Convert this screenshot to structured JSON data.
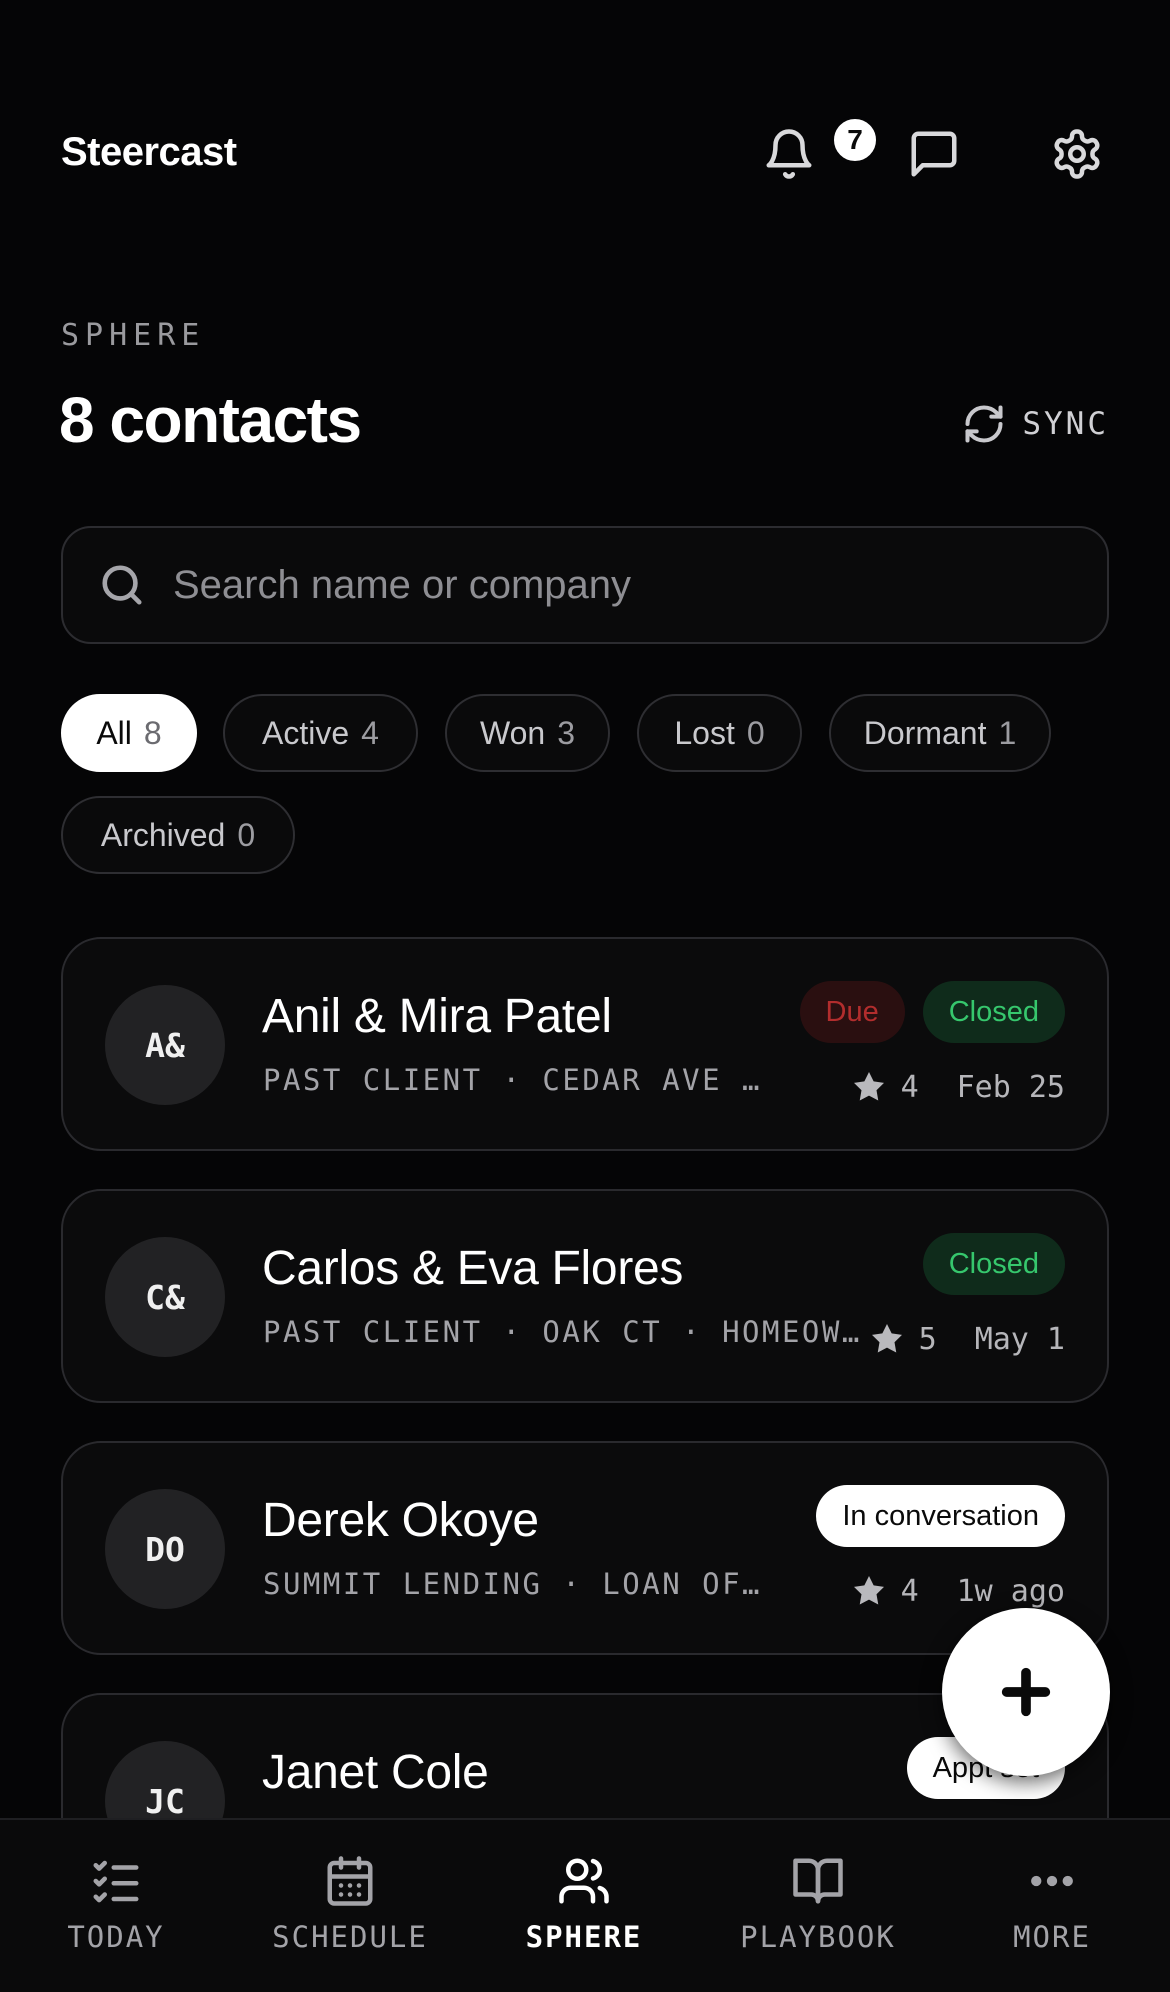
{
  "header": {
    "brand": "Steercast",
    "notifications_count": "7"
  },
  "section": {
    "eyebrow": "SPHERE",
    "title": "8 contacts",
    "sync_label": "SYNC"
  },
  "search": {
    "placeholder": "Search name or company",
    "value": ""
  },
  "filters": [
    {
      "label": "All",
      "count": "8",
      "active": true
    },
    {
      "label": "Active",
      "count": "4",
      "active": false
    },
    {
      "label": "Won",
      "count": "3",
      "active": false
    },
    {
      "label": "Lost",
      "count": "0",
      "active": false
    },
    {
      "label": "Dormant",
      "count": "1",
      "active": false
    },
    {
      "label": "Archived",
      "count": "0",
      "active": false
    }
  ],
  "contacts": [
    {
      "initials": "A&",
      "name": "Anil & Mira Patel",
      "subtitle": "PAST CLIENT · CEDAR AVE …",
      "tags": [
        "Due",
        "Closed"
      ],
      "rating": "4",
      "date": "Feb 25"
    },
    {
      "initials": "C&",
      "name": "Carlos & Eva Flores",
      "subtitle": "PAST CLIENT · OAK CT · HOMEOW…",
      "tags": [
        "Closed"
      ],
      "rating": "5",
      "date": "May 1"
    },
    {
      "initials": "DO",
      "name": "Derek Okoye",
      "subtitle": "SUMMIT LENDING · LOAN OF…",
      "tags": [
        "In conversation"
      ],
      "rating": "4",
      "date": "1w ago"
    },
    {
      "initials": "JC",
      "name": "Janet Cole",
      "subtitle": "",
      "tags": [
        "Appt set"
      ],
      "rating": "",
      "date": ""
    }
  ],
  "nav": [
    {
      "label": "TODAY",
      "icon": "checklist-icon",
      "active": false
    },
    {
      "label": "SCHEDULE",
      "icon": "calendar-icon",
      "active": false
    },
    {
      "label": "SPHERE",
      "icon": "people-icon",
      "active": true
    },
    {
      "label": "PLAYBOOK",
      "icon": "book-icon",
      "active": false
    },
    {
      "label": "MORE",
      "icon": "more-icon",
      "active": false
    }
  ],
  "colors": {
    "background": "#050506",
    "due_text": "#b22d2d",
    "closed_text": "#36c76d",
    "accent": "#ffffff"
  }
}
